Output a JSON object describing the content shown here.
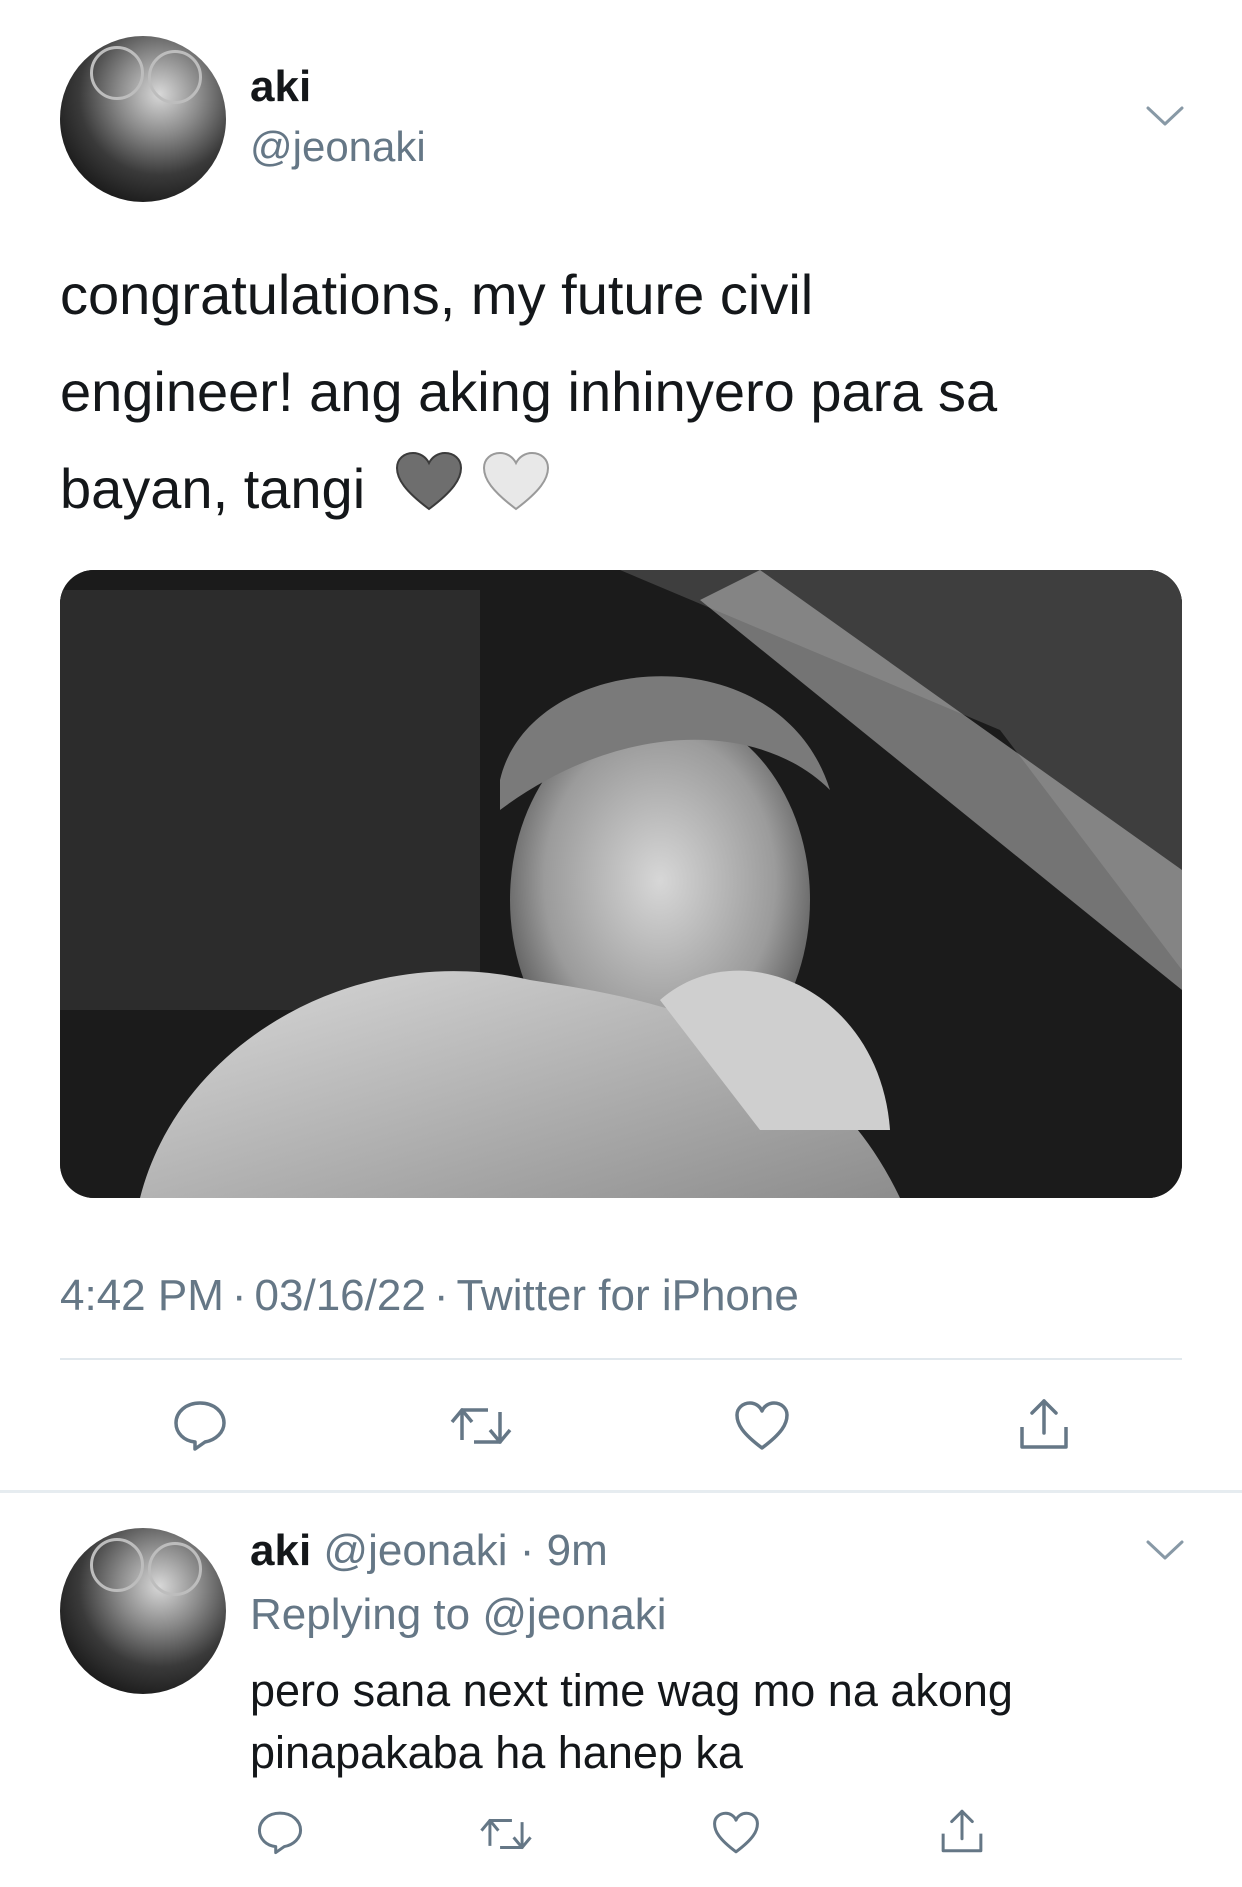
{
  "main_tweet": {
    "author_name": "aki",
    "author_handle": "@jeonaki",
    "text_lines": [
      "congratulations, my future civil",
      "engineer! ang aking inhinyero para sa",
      "bayan, tangi"
    ],
    "emoji": [
      "🩶",
      "🤍"
    ],
    "time": "4:42 PM",
    "date": "03/16/22",
    "source": "Twitter for iPhone",
    "actions": [
      "reply-icon",
      "retweet-icon",
      "like-icon",
      "share-icon"
    ]
  },
  "reply_tweet": {
    "author_name": "aki",
    "author_handle": "@jeonaki",
    "age": "9m",
    "replying_to_label": "Replying to",
    "replying_to_handle": "@jeonaki",
    "text_lines": [
      "pero sana next time wag mo na akong",
      "pinapakaba ha hanep ka"
    ],
    "actions": [
      "reply-icon",
      "retweet-icon",
      "like-icon",
      "share-icon"
    ]
  },
  "colors": {
    "text": "#14171a",
    "secondary": "#657786",
    "divider": "#e1e8ed",
    "icon": "#657786"
  }
}
